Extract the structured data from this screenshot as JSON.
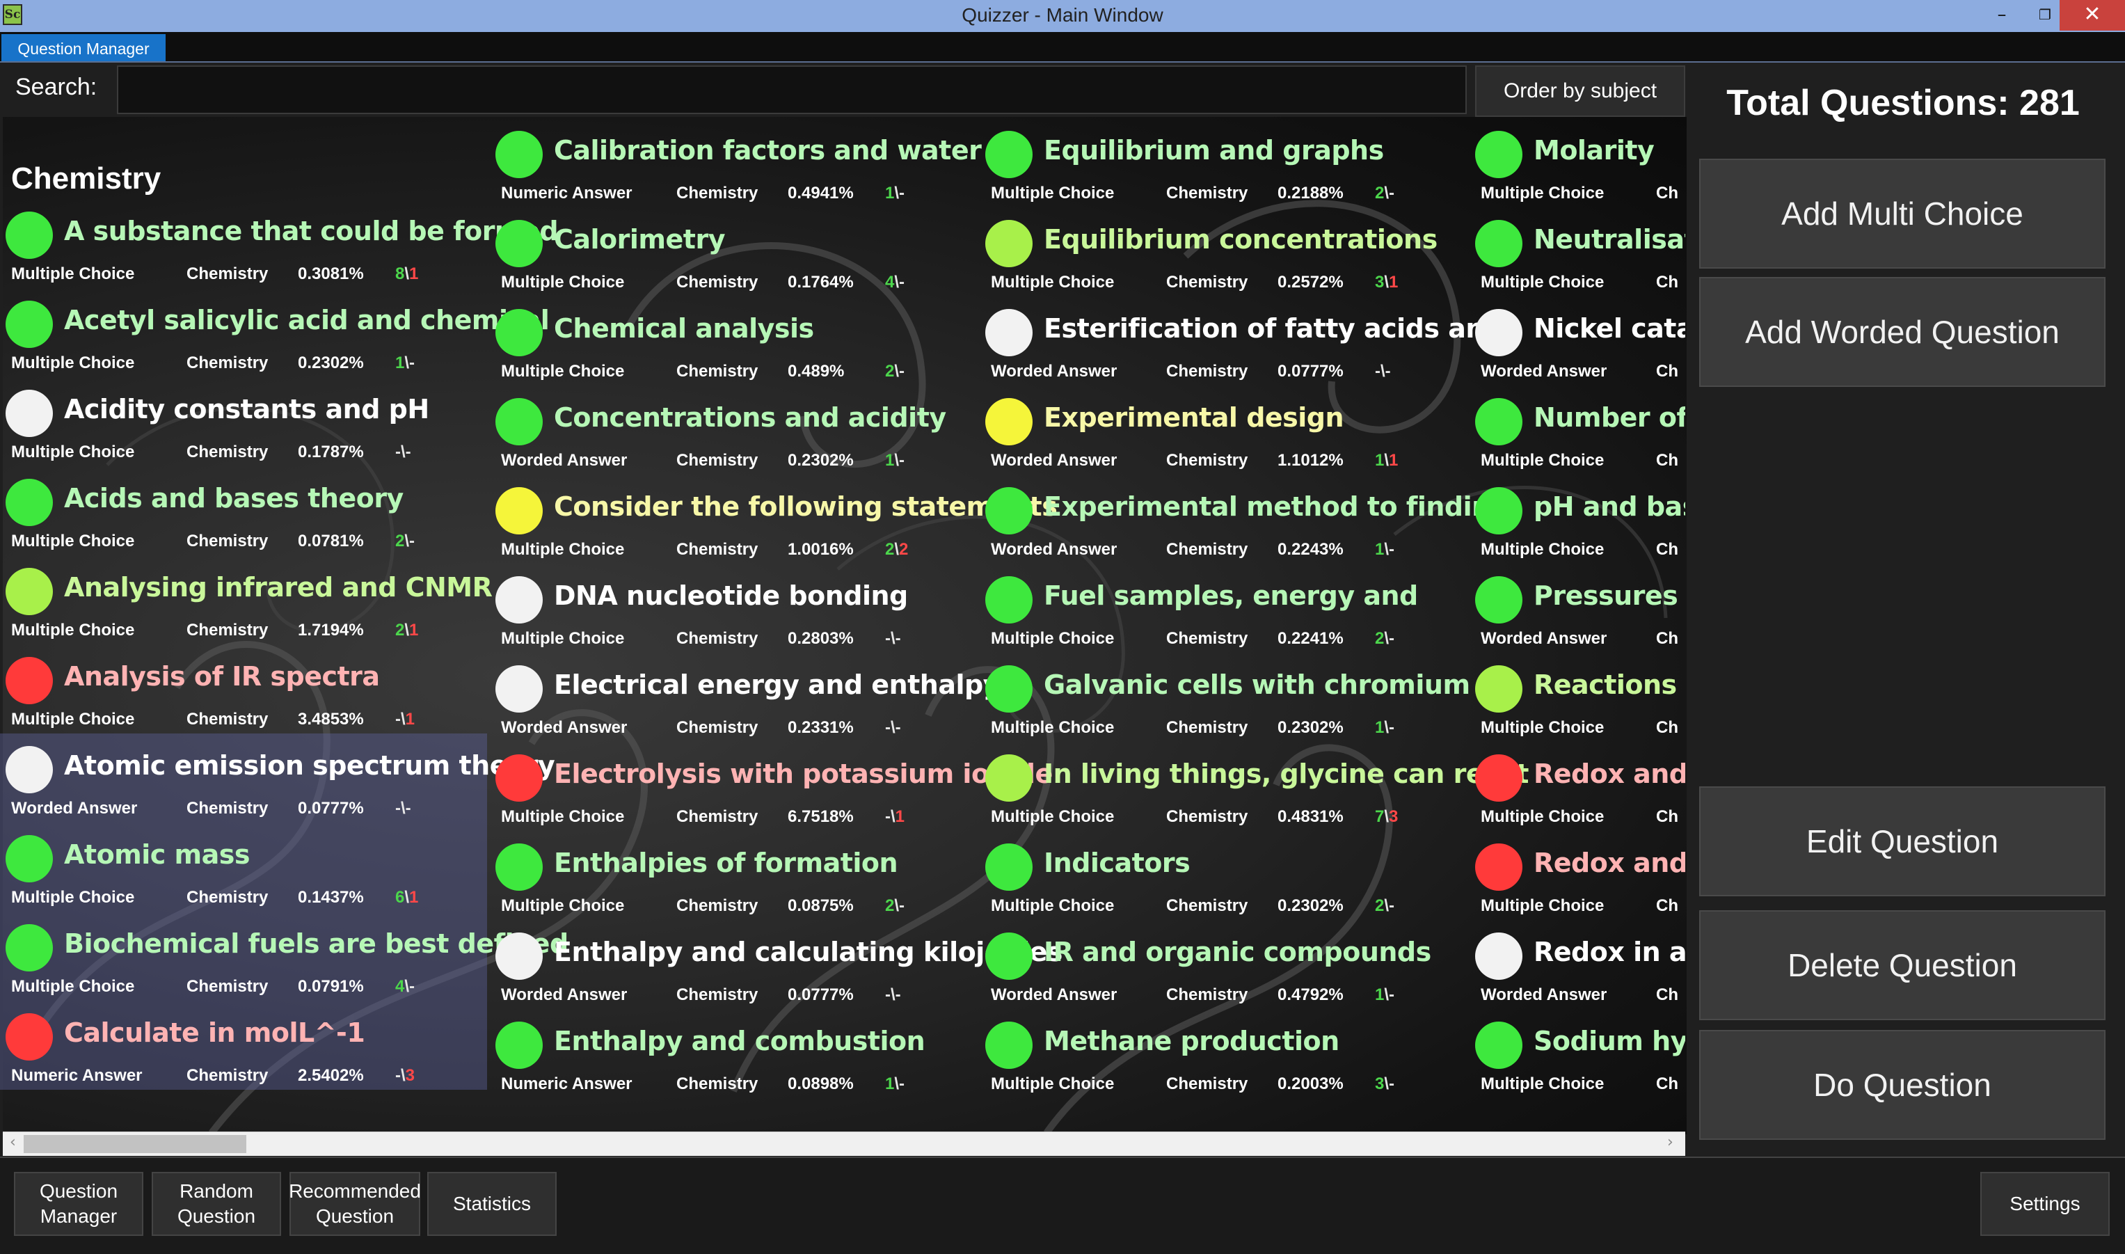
{
  "window": {
    "title": "Quizzer - Main Window",
    "app_icon": "Sc",
    "minimize": "–",
    "maximize": "❐",
    "close": "✕"
  },
  "tabs": [
    {
      "label": "Question Manager",
      "active": true
    }
  ],
  "search": {
    "label": "Search:",
    "value": "",
    "placeholder": ""
  },
  "order_button": "Order by subject",
  "total_questions": "Total Questions: 281",
  "side_buttons": {
    "add_multi": "Add Multi Choice",
    "add_worded": "Add Worded Question",
    "edit": "Edit Question",
    "delete": "Delete Question",
    "do": "Do Question"
  },
  "colors": {
    "green": "#3ee83e",
    "yellow_green": "#a8f04a",
    "white": "#f2f2f2",
    "yellow": "#f5f53a",
    "red": "#ff3a3a"
  },
  "subject_heading": "Chemistry",
  "columns": [
    [
      {
        "title": "A substance that could be formed",
        "status": "green",
        "type": "Multiple Choice",
        "subject": "Chemistry",
        "pct": "0.3081%",
        "s1": "8",
        "s1c": "g",
        "sep": "\\",
        "s2": "1",
        "s2c": "r"
      },
      {
        "title": "Acetyl salicylic acid and chemical",
        "status": "green",
        "type": "Multiple Choice",
        "subject": "Chemistry",
        "pct": "0.2302%",
        "s1": "1",
        "s1c": "g",
        "sep": "\\",
        "s2": "-",
        "s2c": "s"
      },
      {
        "title": "Acidity constants and pH",
        "status": "white",
        "type": "Multiple Choice",
        "subject": "Chemistry",
        "pct": "0.1787%",
        "s1": "-",
        "s1c": "s",
        "sep": "\\",
        "s2": "-",
        "s2c": "s"
      },
      {
        "title": "Acids and bases theory",
        "status": "green",
        "type": "Multiple Choice",
        "subject": "Chemistry",
        "pct": "0.0781%",
        "s1": "2",
        "s1c": "g",
        "sep": "\\",
        "s2": "-",
        "s2c": "s"
      },
      {
        "title": "Analysing infrared and CNMR",
        "status": "yellow_green",
        "type": "Multiple Choice",
        "subject": "Chemistry",
        "pct": "1.7194%",
        "s1": "2",
        "s1c": "g",
        "sep": "\\",
        "s2": "1",
        "s2c": "r"
      },
      {
        "title": "Analysis of IR spectra",
        "status": "red",
        "type": "Multiple Choice",
        "subject": "Chemistry",
        "pct": "3.4853%",
        "s1": "-",
        "s1c": "s",
        "sep": "\\",
        "s2": "1",
        "s2c": "r"
      },
      {
        "title": "Atomic emission spectrum theory",
        "status": "white",
        "type": "Worded Answer",
        "subject": "Chemistry",
        "pct": "0.0777%",
        "s1": "-",
        "s1c": "s",
        "sep": "\\",
        "s2": "-",
        "s2c": "s",
        "selected": true
      },
      {
        "title": "Atomic mass",
        "status": "green",
        "type": "Multiple Choice",
        "subject": "Chemistry",
        "pct": "0.1437%",
        "s1": "6",
        "s1c": "g",
        "sep": "\\",
        "s2": "1",
        "s2c": "r",
        "selected": true
      },
      {
        "title": "Biochemical fuels are best defined",
        "status": "green",
        "type": "Multiple Choice",
        "subject": "Chemistry",
        "pct": "0.0791%",
        "s1": "4",
        "s1c": "g",
        "sep": "\\",
        "s2": "-",
        "s2c": "s",
        "selected": true
      },
      {
        "title": "Calculate in molL^-1",
        "status": "red",
        "type": "Numeric Answer",
        "subject": "Chemistry",
        "pct": "2.5402%",
        "s1": "-",
        "s1c": "s",
        "sep": "\\",
        "s2": "3",
        "s2c": "r",
        "selected": true
      }
    ],
    [
      {
        "title": "Calibration factors and water",
        "status": "green",
        "type": "Numeric Answer",
        "subject": "Chemistry",
        "pct": "0.4941%",
        "s1": "1",
        "s1c": "g",
        "sep": "\\",
        "s2": "-",
        "s2c": "s"
      },
      {
        "title": "Calorimetry",
        "status": "green",
        "type": "Multiple Choice",
        "subject": "Chemistry",
        "pct": "0.1764%",
        "s1": "4",
        "s1c": "g",
        "sep": "\\",
        "s2": "-",
        "s2c": "s"
      },
      {
        "title": "Chemical analysis",
        "status": "green",
        "type": "Multiple Choice",
        "subject": "Chemistry",
        "pct": "0.489%",
        "s1": "2",
        "s1c": "g",
        "sep": "\\",
        "s2": "-",
        "s2c": "s"
      },
      {
        "title": "Concentrations and acidity",
        "status": "green",
        "type": "Worded Answer",
        "subject": "Chemistry",
        "pct": "0.2302%",
        "s1": "1",
        "s1c": "g",
        "sep": "\\",
        "s2": "-",
        "s2c": "s"
      },
      {
        "title": "Consider the following statements",
        "status": "yellow",
        "type": "Multiple Choice",
        "subject": "Chemistry",
        "pct": "1.0016%",
        "s1": "2",
        "s1c": "g",
        "sep": "\\",
        "s2": "2",
        "s2c": "r"
      },
      {
        "title": "DNA nucleotide bonding",
        "status": "white",
        "type": "Multiple Choice",
        "subject": "Chemistry",
        "pct": "0.2803%",
        "s1": "-",
        "s1c": "s",
        "sep": "\\",
        "s2": "-",
        "s2c": "s"
      },
      {
        "title": "Electrical energy and enthalpy",
        "status": "white",
        "type": "Worded Answer",
        "subject": "Chemistry",
        "pct": "0.2331%",
        "s1": "-",
        "s1c": "s",
        "sep": "\\",
        "s2": "-",
        "s2c": "s"
      },
      {
        "title": "Electrolysis with potassium iodide",
        "status": "red",
        "type": "Multiple Choice",
        "subject": "Chemistry",
        "pct": "6.7518%",
        "s1": "-",
        "s1c": "s",
        "sep": "\\",
        "s2": "1",
        "s2c": "r"
      },
      {
        "title": "Enthalpies of formation",
        "status": "green",
        "type": "Multiple Choice",
        "subject": "Chemistry",
        "pct": "0.0875%",
        "s1": "2",
        "s1c": "g",
        "sep": "\\",
        "s2": "-",
        "s2c": "s"
      },
      {
        "title": "Enthalpy and calculating kilojoules",
        "status": "white",
        "type": "Worded Answer",
        "subject": "Chemistry",
        "pct": "0.0777%",
        "s1": "-",
        "s1c": "s",
        "sep": "\\",
        "s2": "-",
        "s2c": "s"
      },
      {
        "title": "Enthalpy and combustion",
        "status": "green",
        "type": "Numeric Answer",
        "subject": "Chemistry",
        "pct": "0.0898%",
        "s1": "1",
        "s1c": "g",
        "sep": "\\",
        "s2": "-",
        "s2c": "s"
      }
    ],
    [
      {
        "title": "Equilibrium and graphs",
        "status": "green",
        "type": "Multiple Choice",
        "subject": "Chemistry",
        "pct": "0.2188%",
        "s1": "2",
        "s1c": "g",
        "sep": "\\",
        "s2": "-",
        "s2c": "s"
      },
      {
        "title": "Equilibrium concentrations",
        "status": "yellow_green",
        "type": "Multiple Choice",
        "subject": "Chemistry",
        "pct": "0.2572%",
        "s1": "3",
        "s1c": "g",
        "sep": "\\",
        "s2": "1",
        "s2c": "r"
      },
      {
        "title": "Esterification of fatty acids and",
        "status": "white",
        "type": "Worded Answer",
        "subject": "Chemistry",
        "pct": "0.0777%",
        "s1": "-",
        "s1c": "s",
        "sep": "\\",
        "s2": "-",
        "s2c": "s"
      },
      {
        "title": "Experimental design",
        "status": "yellow",
        "type": "Worded Answer",
        "subject": "Chemistry",
        "pct": "1.1012%",
        "s1": "1",
        "s1c": "g",
        "sep": "\\",
        "s2": "1",
        "s2c": "r"
      },
      {
        "title": "Experimental method to finding",
        "status": "green",
        "type": "Worded Answer",
        "subject": "Chemistry",
        "pct": "0.2243%",
        "s1": "1",
        "s1c": "g",
        "sep": "\\",
        "s2": "-",
        "s2c": "s"
      },
      {
        "title": "Fuel samples, energy and",
        "status": "green",
        "type": "Multiple Choice",
        "subject": "Chemistry",
        "pct": "0.2241%",
        "s1": "2",
        "s1c": "g",
        "sep": "\\",
        "s2": "-",
        "s2c": "s"
      },
      {
        "title": "Galvanic cells with chromium",
        "status": "green",
        "type": "Multiple Choice",
        "subject": "Chemistry",
        "pct": "0.2302%",
        "s1": "1",
        "s1c": "g",
        "sep": "\\",
        "s2": "-",
        "s2c": "s"
      },
      {
        "title": "In living things, glycine can react",
        "status": "yellow_green",
        "type": "Multiple Choice",
        "subject": "Chemistry",
        "pct": "0.4831%",
        "s1": "7",
        "s1c": "g",
        "sep": "\\",
        "s2": "3",
        "s2c": "r"
      },
      {
        "title": "Indicators",
        "status": "green",
        "type": "Multiple Choice",
        "subject": "Chemistry",
        "pct": "0.2302%",
        "s1": "2",
        "s1c": "g",
        "sep": "\\",
        "s2": "-",
        "s2c": "s"
      },
      {
        "title": "IR and organic compounds",
        "status": "green",
        "type": "Worded Answer",
        "subject": "Chemistry",
        "pct": "0.4792%",
        "s1": "1",
        "s1c": "g",
        "sep": "\\",
        "s2": "-",
        "s2c": "s"
      },
      {
        "title": "Methane production",
        "status": "green",
        "type": "Multiple Choice",
        "subject": "Chemistry",
        "pct": "0.2003%",
        "s1": "3",
        "s1c": "g",
        "sep": "\\",
        "s2": "-",
        "s2c": "s"
      }
    ],
    [
      {
        "title": "Molarity",
        "status": "green",
        "type": "Multiple Choice",
        "subject": "Ch"
      },
      {
        "title": "Neutralisatio",
        "status": "green",
        "type": "Multiple Choice",
        "subject": "Ch"
      },
      {
        "title": "Nickel cataly",
        "status": "white",
        "type": "Worded Answer",
        "subject": "Ch"
      },
      {
        "title": "Number of a",
        "status": "green",
        "type": "Multiple Choice",
        "subject": "Ch"
      },
      {
        "title": "pH and basic",
        "status": "green",
        "type": "Multiple Choice",
        "subject": "Ch"
      },
      {
        "title": "Pressures and",
        "status": "green",
        "type": "Worded Answer",
        "subject": "Ch"
      },
      {
        "title": "Reactions",
        "status": "yellow_green",
        "type": "Multiple Choice",
        "subject": "Ch"
      },
      {
        "title": "Redox and el",
        "status": "red",
        "type": "Multiple Choice",
        "subject": "Ch"
      },
      {
        "title": "Redox and p",
        "status": "red",
        "type": "Multiple Choice",
        "subject": "Ch"
      },
      {
        "title": "Redox in alka",
        "status": "white",
        "type": "Worded Answer",
        "subject": "Ch"
      },
      {
        "title": "Sodium hydr",
        "status": "green",
        "type": "Multiple Choice",
        "subject": "Ch"
      }
    ]
  ],
  "bottom_nav": [
    {
      "label": "Question Manager"
    },
    {
      "label": "Random Question"
    },
    {
      "label": "Recommended Question"
    },
    {
      "label": "Statistics"
    }
  ],
  "settings": "Settings",
  "scroll": {
    "left_arrow": "‹",
    "right_arrow": "›"
  }
}
